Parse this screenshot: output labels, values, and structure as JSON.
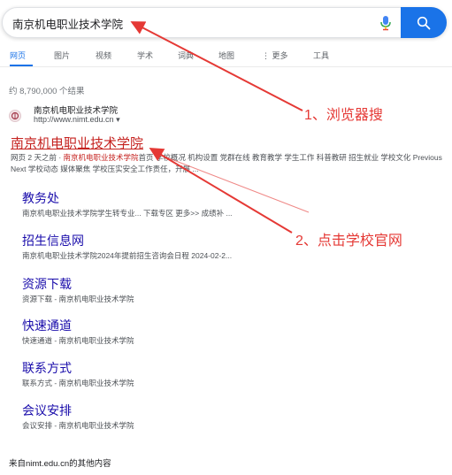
{
  "search": {
    "query": "南京机电职业技术学院"
  },
  "tabs": [
    "网页",
    "图片",
    "视频",
    "学术",
    "词典",
    "地图",
    "更多",
    "工具"
  ],
  "results_count": "约 8,790,000 个结果",
  "result": {
    "site_name": "南京机电职业技术学院",
    "site_url": "http://www.nimt.edu.cn",
    "url_caret": "▾",
    "title": "南京机电职业技术学院",
    "snippet_prefix": "网页 2 天之前 · ",
    "snippet_highlight": "南京机电职业技术学院",
    "snippet_rest": "首页 学校概况 机构设置 党群在线 教育教学 学生工作 科普教研 招生就业 学校文化 Previous Next 学校动态 媒体聚焦 学校压实安全工作责任，开展 ..."
  },
  "sitelinks": [
    {
      "title": "教务处",
      "desc": "南京机电职业技术学院学生转专业... 下载专区 更多>> 成绩补 ..."
    },
    {
      "title": "招生信息网",
      "desc": "南京机电职业技术学院2024年提前招生咨询会日程 2024-02-2..."
    },
    {
      "title": "资源下载",
      "desc": "资源下载 - 南京机电职业技术学院"
    },
    {
      "title": "快速通道",
      "desc": "快速通道 - 南京机电职业技术学院"
    },
    {
      "title": "联系方式",
      "desc": "联系方式 - 南京机电职业技术学院"
    },
    {
      "title": "会议安排",
      "desc": "会议安排 - 南京机电职业技术学院"
    }
  ],
  "footer_text": "来自nimt.edu.cn的其他内容",
  "annotations": {
    "step1": "1、浏览器搜",
    "step2": "2、点击学校官网"
  },
  "colors": {
    "accent_blue": "#1a73e8",
    "link_purple": "#1a0dab",
    "annotation_red": "#e53935",
    "visited_title_red": "#c5221f"
  },
  "icons": [
    "microphone-icon",
    "search-icon",
    "favicon-icon"
  ]
}
